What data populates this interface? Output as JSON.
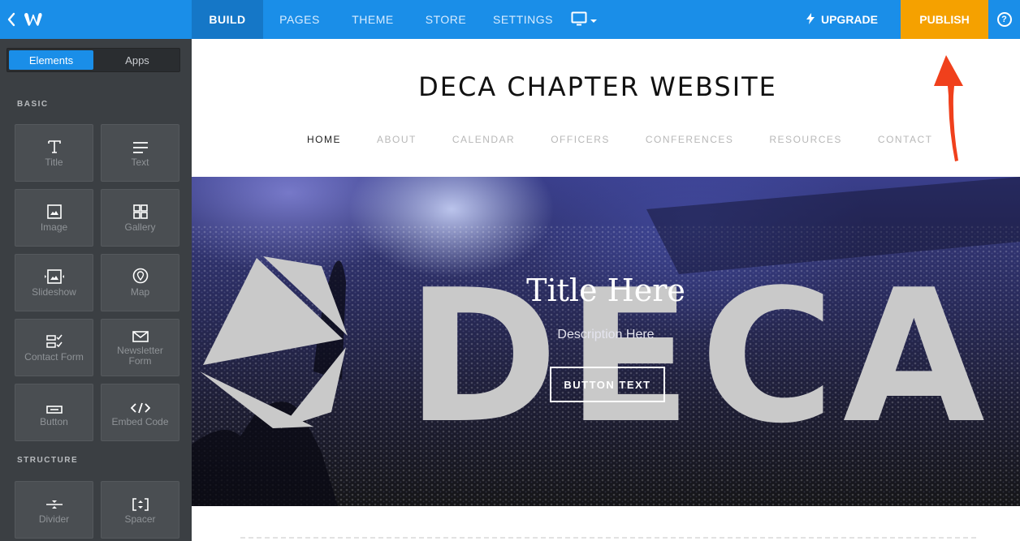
{
  "topbar": {
    "nav": {
      "build": "BUILD",
      "pages": "PAGES",
      "theme": "THEME",
      "store": "STORE",
      "settings": "SETTINGS"
    },
    "upgrade_label": "UPGRADE",
    "publish_label": "PUBLISH",
    "help_label": "?"
  },
  "sidebar": {
    "tabs": {
      "elements": "Elements",
      "apps": "Apps"
    },
    "sections": {
      "basic": "BASIC",
      "structure": "STRUCTURE"
    },
    "tiles": {
      "title": "Title",
      "text": "Text",
      "image": "Image",
      "gallery": "Gallery",
      "slideshow": "Slideshow",
      "map": "Map",
      "contact_form": "Contact Form",
      "newsletter_form": "Newsletter Form",
      "button": "Button",
      "embed_code": "Embed Code",
      "divider": "Divider",
      "spacer": "Spacer"
    }
  },
  "site": {
    "title": "DECA CHAPTER WEBSITE",
    "nav": [
      "HOME",
      "ABOUT",
      "CALENDAR",
      "OFFICERS",
      "CONFERENCES",
      "RESOURCES",
      "CONTACT"
    ],
    "hero": {
      "logo_text": "DECA",
      "title": "Title Here",
      "description": "Description Here",
      "button": "BUTTON TEXT"
    }
  },
  "colors": {
    "topbar": "#1a8ee8",
    "publish": "#f5a100",
    "sidebar": "#3b3f43",
    "arrow": "#f0401c"
  }
}
